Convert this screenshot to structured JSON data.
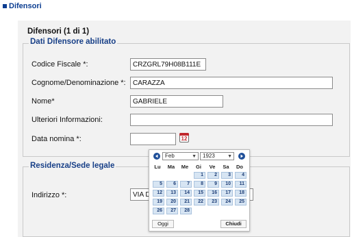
{
  "page": {
    "section_title": "Difensori"
  },
  "panel": {
    "title": "Difensori (1 di 1)",
    "group1_legend": "Dati Difensore abilitato",
    "group2_legend": "Residenza/Sede legale"
  },
  "fields": {
    "codice_fiscale": {
      "label": "Codice Fiscale *:",
      "value": "CRZGRL79H08B111E"
    },
    "cognome": {
      "label": "Cognome/Denominazione *:",
      "value": "CARAZZA"
    },
    "nome": {
      "label": "Nome*",
      "value": "GABRIELE"
    },
    "ulteriori": {
      "label": "Ulteriori Informazioni:",
      "value": ""
    },
    "data_nomina": {
      "label": "Data nomina *:",
      "value": ""
    },
    "indirizzo": {
      "label": "Indirizzo *:",
      "value": "VIA DU"
    }
  },
  "calendar_icon": {
    "text": "12"
  },
  "datepicker": {
    "month": "Feb",
    "year": "1923",
    "weekdays": [
      "Lu",
      "Ma",
      "Me",
      "Gi",
      "Ve",
      "Sa",
      "Do"
    ],
    "weeks": [
      [
        "",
        "",
        "",
        "1",
        "2",
        "3",
        "4"
      ],
      [
        "5",
        "6",
        "7",
        "8",
        "9",
        "10",
        "11"
      ],
      [
        "12",
        "13",
        "14",
        "15",
        "16",
        "17",
        "18"
      ],
      [
        "19",
        "20",
        "21",
        "22",
        "23",
        "24",
        "25"
      ],
      [
        "26",
        "27",
        "28",
        "",
        "",
        "",
        ""
      ]
    ],
    "today_label": "Oggi",
    "close_label": "Chiudi",
    "colors": {
      "nav": "#1f4f99",
      "day_bg": "#d7e5f3",
      "day_text": "#1f3f77"
    }
  }
}
